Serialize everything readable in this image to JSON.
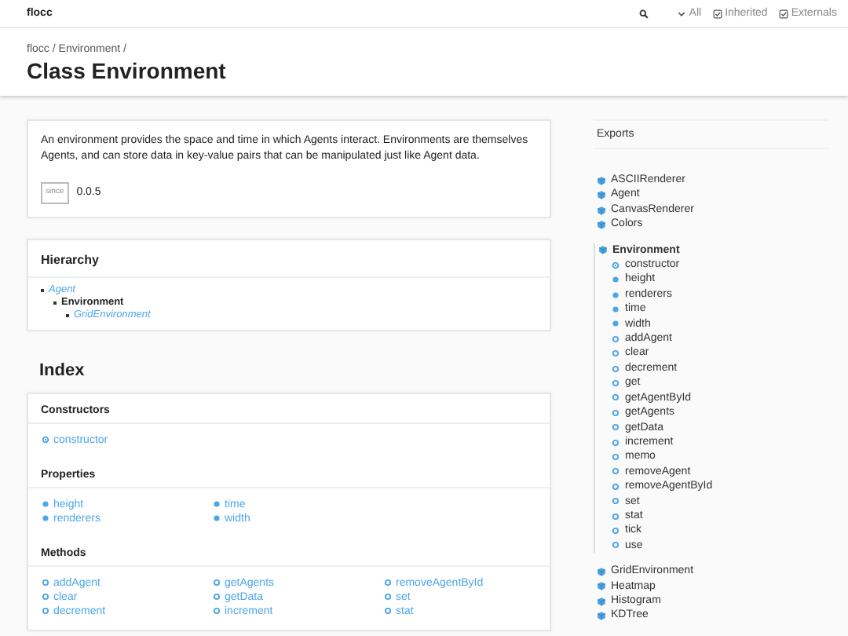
{
  "header": {
    "title": "flocc",
    "filters": [
      {
        "label": "All",
        "kind": "dropdown"
      },
      {
        "label": "Inherited",
        "kind": "checkbox",
        "checked": true
      },
      {
        "label": "Externals",
        "kind": "checkbox",
        "checked": true
      }
    ]
  },
  "breadcrumb": [
    "flocc /",
    "Environment /"
  ],
  "title": "Class Environment",
  "description": {
    "text": "An environment provides the space and time in which Agents interact. Environments are themselves Agents, and can store data in key-value pairs that can be manipulated just like Agent data.",
    "tag": "since",
    "version": "0.0.5"
  },
  "hierarchy": {
    "title": "Hierarchy",
    "items": [
      {
        "label": "Agent",
        "current": false,
        "children": [
          {
            "label": "Environment",
            "current": true,
            "children": [
              {
                "label": "GridEnvironment",
                "current": false
              }
            ]
          }
        ]
      }
    ]
  },
  "index": {
    "title": "Index",
    "sections": [
      {
        "title": "Constructors",
        "items": [
          {
            "label": "constructor",
            "kind": "constructor"
          }
        ]
      },
      {
        "title": "Properties",
        "items": [
          {
            "label": "height",
            "kind": "property"
          },
          {
            "label": "renderers",
            "kind": "property"
          },
          {
            "label": "time",
            "kind": "property"
          },
          {
            "label": "width",
            "kind": "property"
          }
        ]
      },
      {
        "title": "Methods",
        "items": [
          {
            "label": "addAgent",
            "kind": "method"
          },
          {
            "label": "clear",
            "kind": "method"
          },
          {
            "label": "decrement",
            "kind": "method"
          },
          {
            "label": "getAgents",
            "kind": "method"
          },
          {
            "label": "getData",
            "kind": "method"
          },
          {
            "label": "increment",
            "kind": "method"
          },
          {
            "label": "removeAgentById",
            "kind": "method"
          },
          {
            "label": "set",
            "kind": "method"
          },
          {
            "label": "stat",
            "kind": "method"
          }
        ]
      }
    ]
  },
  "sidebar": {
    "title": "Exports",
    "groups": [
      [
        {
          "label": "ASCIIRenderer",
          "kind": "class"
        },
        {
          "label": "Agent",
          "kind": "class"
        },
        {
          "label": "CanvasRenderer",
          "kind": "class"
        },
        {
          "label": "Colors",
          "kind": "class"
        }
      ],
      [
        {
          "label": "Environment",
          "kind": "class",
          "selected": true,
          "children": [
            {
              "label": "constructor",
              "kind": "constructor"
            },
            {
              "label": "height",
              "kind": "property"
            },
            {
              "label": "renderers",
              "kind": "property"
            },
            {
              "label": "time",
              "kind": "property"
            },
            {
              "label": "width",
              "kind": "property"
            },
            {
              "label": "addAgent",
              "kind": "method"
            },
            {
              "label": "clear",
              "kind": "method"
            },
            {
              "label": "decrement",
              "kind": "method"
            },
            {
              "label": "get",
              "kind": "method"
            },
            {
              "label": "getAgentById",
              "kind": "method"
            },
            {
              "label": "getAgents",
              "kind": "method"
            },
            {
              "label": "getData",
              "kind": "method"
            },
            {
              "label": "increment",
              "kind": "method"
            },
            {
              "label": "memo",
              "kind": "method"
            },
            {
              "label": "removeAgent",
              "kind": "method"
            },
            {
              "label": "removeAgentById",
              "kind": "method"
            },
            {
              "label": "set",
              "kind": "method"
            },
            {
              "label": "stat",
              "kind": "method"
            },
            {
              "label": "tick",
              "kind": "method"
            },
            {
              "label": "use",
              "kind": "method"
            }
          ]
        }
      ],
      [
        {
          "label": "GridEnvironment",
          "kind": "class",
          "selected": false
        },
        {
          "label": "Heatmap",
          "kind": "class",
          "selected": false
        },
        {
          "label": "Histogram",
          "kind": "class",
          "selected": false
        },
        {
          "label": "KDTree",
          "kind": "class",
          "selected": false
        }
      ]
    ]
  }
}
